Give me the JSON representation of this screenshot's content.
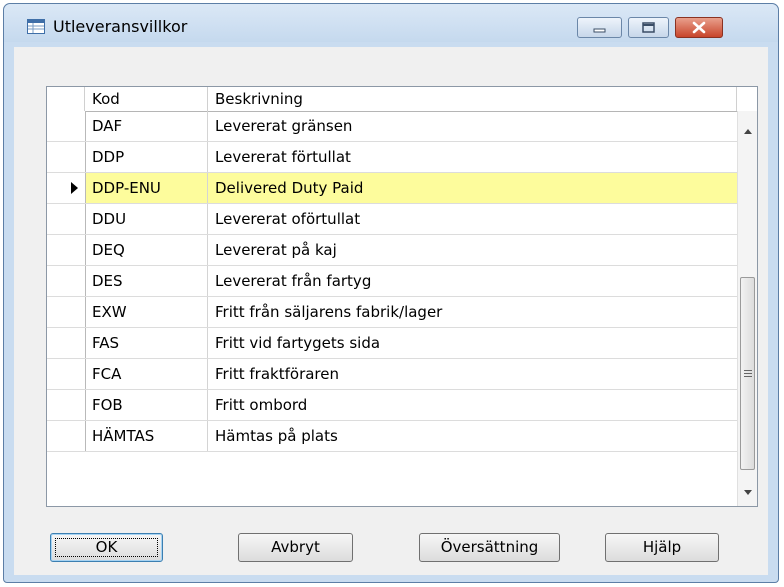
{
  "window": {
    "title": "Utleveransvillkor",
    "icon": "table-window-icon",
    "controls": {
      "minimize": "minimize-icon",
      "maximize": "maximize-icon",
      "close": "close-icon"
    }
  },
  "table": {
    "columns": [
      "Kod",
      "Beskrivning"
    ],
    "rows": [
      {
        "kod": "DAF",
        "beskrivning": "Levererat gränsen",
        "selected": false
      },
      {
        "kod": "DDP",
        "beskrivning": "Levererat förtullat",
        "selected": false
      },
      {
        "kod": "DDP-ENU",
        "beskrivning": "Delivered Duty Paid",
        "selected": true
      },
      {
        "kod": "DDU",
        "beskrivning": "Levererat oförtullat",
        "selected": false
      },
      {
        "kod": "DEQ",
        "beskrivning": "Levererat på kaj",
        "selected": false
      },
      {
        "kod": "DES",
        "beskrivning": "Levererat från fartyg",
        "selected": false
      },
      {
        "kod": "EXW",
        "beskrivning": "Fritt från säljarens fabrik/lager",
        "selected": false
      },
      {
        "kod": "FAS",
        "beskrivning": "Fritt vid fartygets sida",
        "selected": false
      },
      {
        "kod": "FCA",
        "beskrivning": "Fritt fraktföraren",
        "selected": false
      },
      {
        "kod": "FOB",
        "beskrivning": "Fritt ombord",
        "selected": false
      },
      {
        "kod": "HÄMTAS",
        "beskrivning": "Hämtas på plats",
        "selected": false
      }
    ],
    "scroll_position": 0.62
  },
  "buttons": {
    "ok": "OK",
    "cancel": "Avbryt",
    "translation": "Översättning",
    "help": "Hjälp"
  },
  "colors": {
    "selected_row": "#fdfc9c",
    "title_bar": "#c9dcf0",
    "close_button": "#c8452b"
  }
}
